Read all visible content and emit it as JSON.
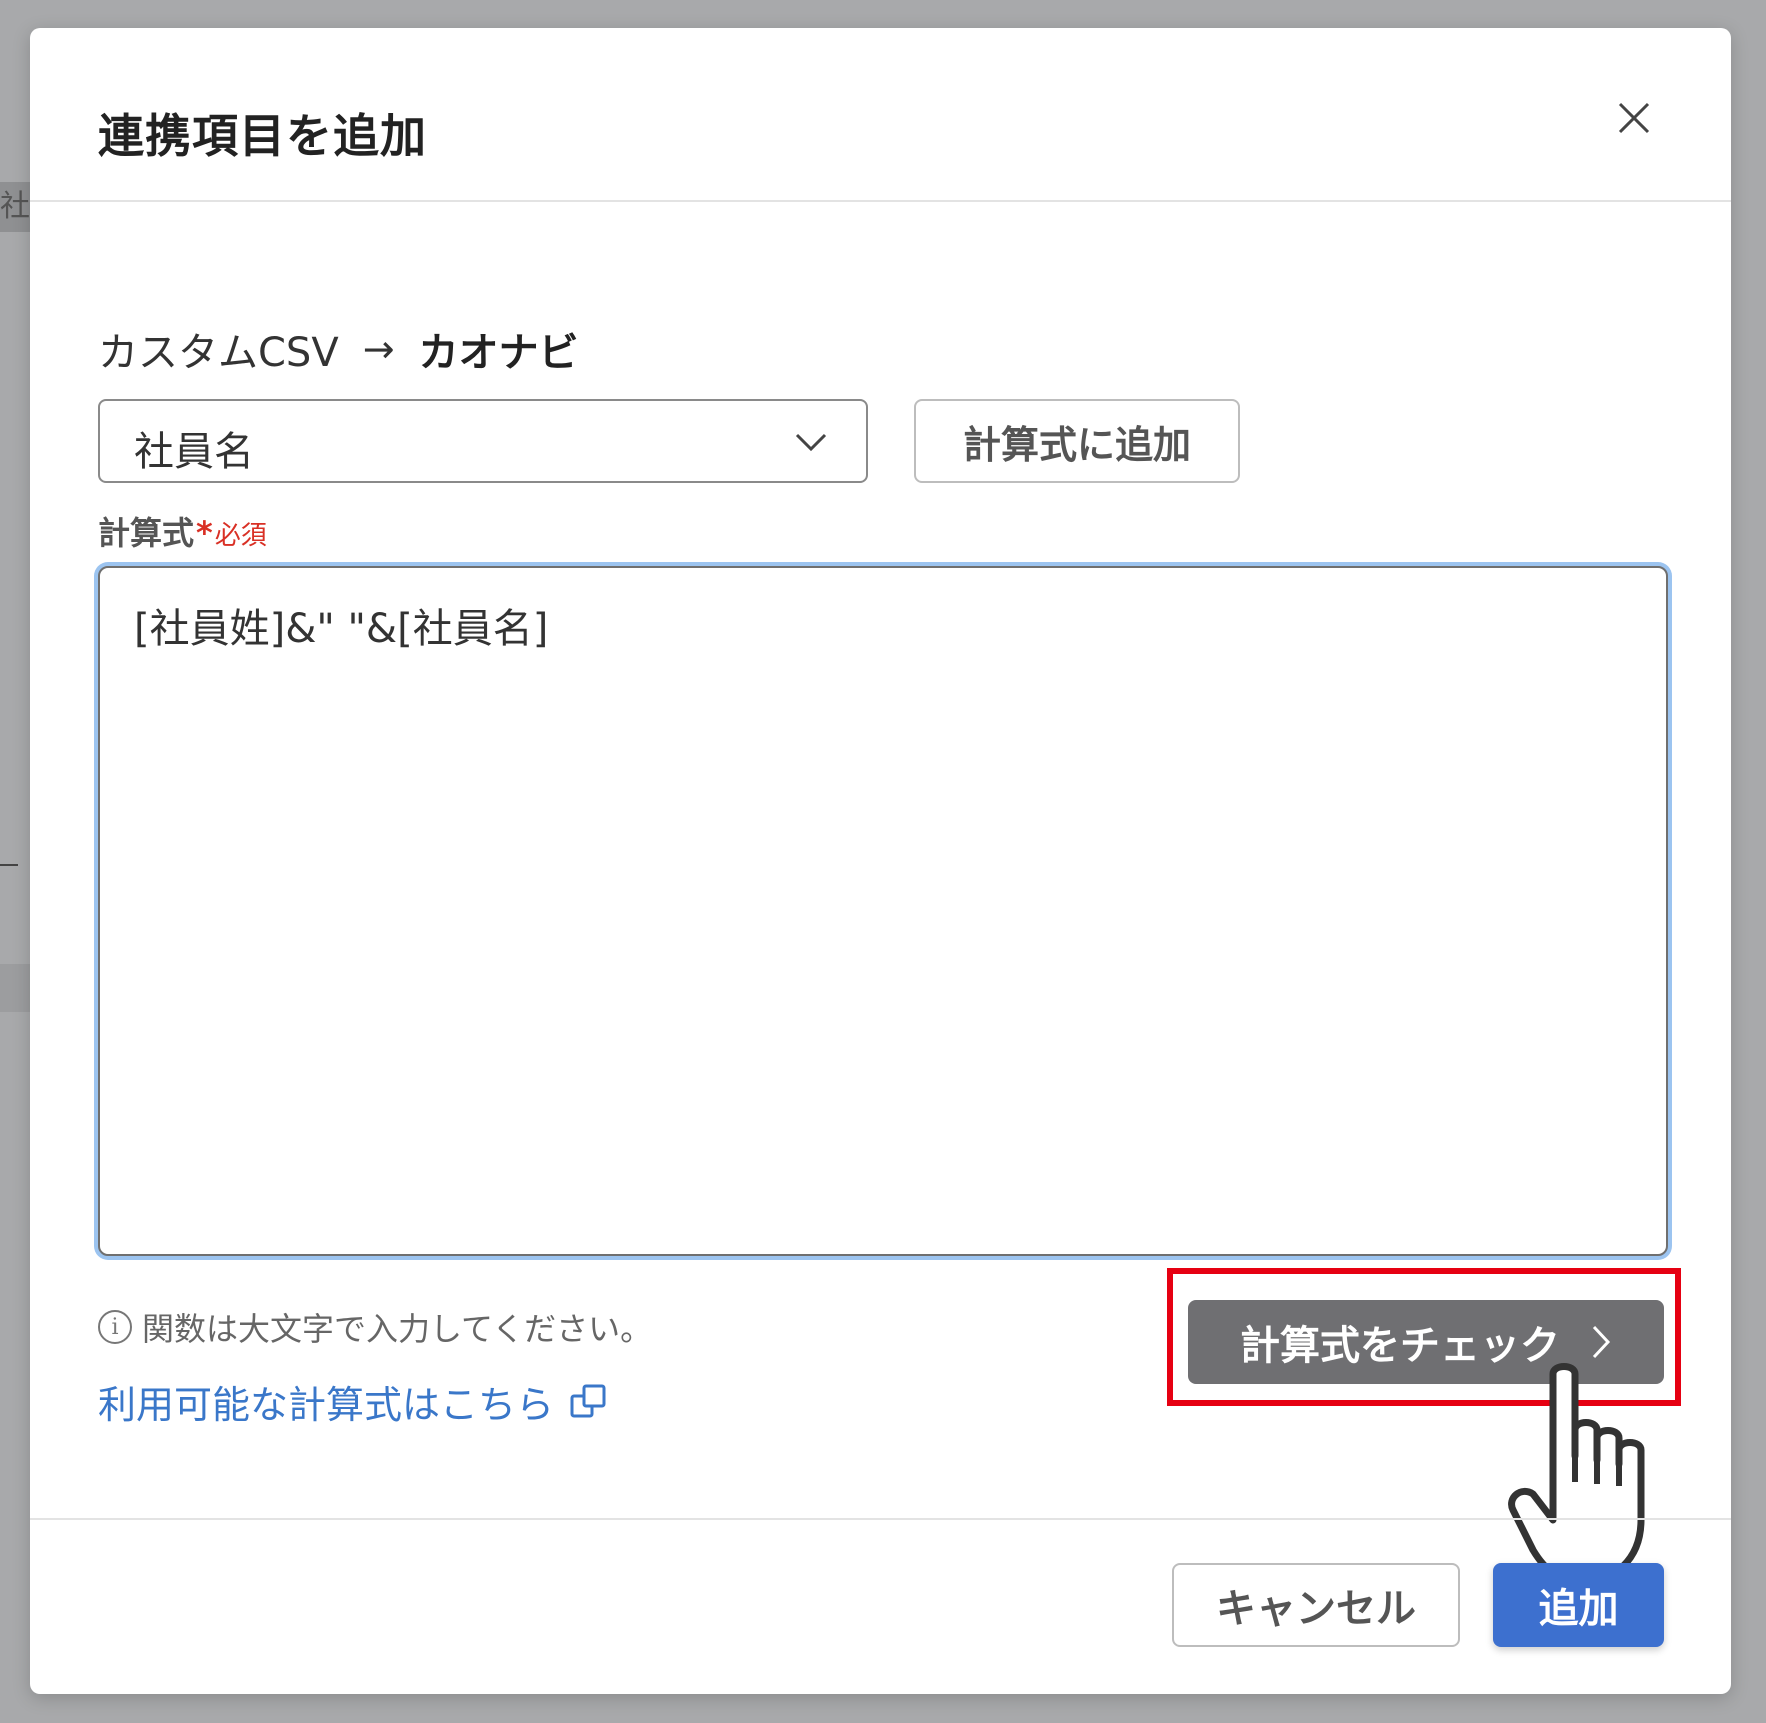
{
  "background": {
    "fragment_text": "社"
  },
  "dialog": {
    "title": "連携項目を追加",
    "close_icon": "close-icon"
  },
  "mapping": {
    "source": "カスタムCSV",
    "arrow": "→",
    "target": "カオナビ"
  },
  "field_select": {
    "selected_value": "社員名",
    "icon": "chevron-down-icon"
  },
  "add_to_formula_label": "計算式に追加",
  "formula_field": {
    "label": "計算式",
    "required_mark": "*",
    "required_text": "必須",
    "value": "[社員姓]&\" \"&[社員名]"
  },
  "hint": {
    "icon": "info-icon",
    "icon_glyph": "i",
    "text": "関数は大文字で入力してください。"
  },
  "formula_link": {
    "text": "利用可能な計算式はこちら",
    "icon": "external-link-icon"
  },
  "check_button": {
    "label": "計算式をチェック",
    "icon": "chevron-right-icon"
  },
  "footer": {
    "cancel_label": "キャンセル",
    "submit_label": "追加"
  },
  "colors": {
    "primary": "#3d70cf",
    "check_button": "#6f6f72",
    "link": "#3a77c9",
    "required": "#d93025",
    "highlight": "#e60012",
    "focus_ring": "#9cc4f0"
  }
}
